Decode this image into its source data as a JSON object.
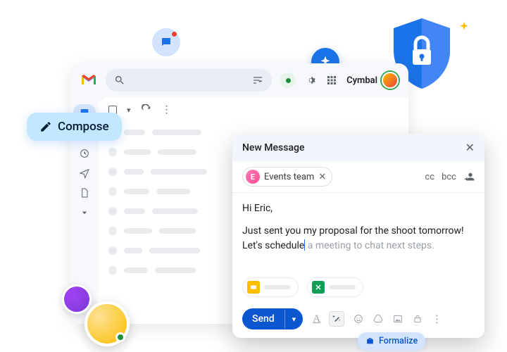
{
  "brand": {
    "name": "Cymbal"
  },
  "compose_button": {
    "label": "Compose"
  },
  "compose": {
    "title": "New Message",
    "recipient_chip": {
      "initial": "E",
      "label": "Events team"
    },
    "cc_label": "cc",
    "bcc_label": "bcc",
    "body": {
      "greeting": "Hi Eric,",
      "line1": "Just sent you my proposal for the shoot tomorrow!",
      "typed": "Let's schedule",
      "suggestion": " a meeting to chat next steps."
    },
    "send_label": "Send"
  },
  "formalize": {
    "label": "Formalize"
  },
  "icons": {
    "pencil": "pencil-icon",
    "search": "search-icon",
    "tune": "tune-icon",
    "gear": "gear-icon",
    "apps": "apps-icon",
    "refresh": "refresh-icon",
    "overflow": "overflow-icon",
    "shield": "shield-icon",
    "sparkle": "sparkle-icon",
    "chat": "chat-icon",
    "close": "close-icon",
    "person_add": "person-add-icon",
    "briefcase": "briefcase-icon"
  }
}
